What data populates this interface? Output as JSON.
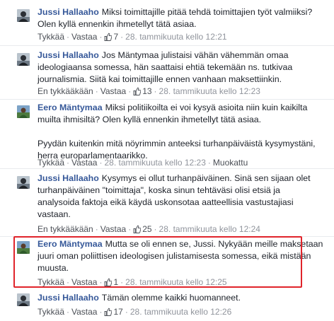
{
  "comments": [
    {
      "author": "Jussi Hallaaho",
      "text": "Miksi toimittajille pitää tehdä toimittajien työt valmiiksi? Olen kyllä ennenkin ihmetellyt tätä asiaa.",
      "like_label": "Tykkää",
      "reply_label": "Vastaa",
      "likes": "7",
      "timestamp": "28. tammikuuta kello 12:21",
      "avatar_icon": "profile-photo-icon"
    },
    {
      "author": "Jussi Hallaaho",
      "text": "Jos Mäntymaa julistaisi vähän vähemmän omaa ideologiaansa somessa, hän saattaisi ehtiä tekemään ns. tutkivaa journalismia. Siitä kai toimittajille ennen vanhaan maksettiinkin.",
      "like_label": "En tykkääkään",
      "reply_label": "Vastaa",
      "likes": "13",
      "timestamp": "28. tammikuuta kello 12:23",
      "avatar_icon": "profile-photo-icon"
    },
    {
      "author": "Eero Mäntymaa",
      "text": "Miksi politiikoilta ei voi kysyä asioita niin kuin kaikilta muilta ihmisiltä? Olen kyllä ennenkin ihmetellyt tätä asiaa.",
      "text2": "Pyydän kuitenkin mitä nöyrimmin anteeksi turhanpäiväistä kysymystäni, herra europarlamentaarikko.",
      "like_label": "Tykkää",
      "reply_label": "Vastaa",
      "timestamp": "28. tammikuuta kello 12:23",
      "edited_label": "Muokattu",
      "avatar_icon": "profile-photo-icon"
    },
    {
      "author": "Jussi Hallaaho",
      "text": "Kysymys ei ollut turhanpäiväinen. Sinä sen sijaan olet turhanpäiväinen \"toimittaja\", koska sinun tehtäväsi olisi etsiä ja analysoida faktoja eikä käydä uskonsotaa aatteellisia vastustajiasi vastaan.",
      "like_label": "En tykkääkään",
      "reply_label": "Vastaa",
      "likes": "25",
      "timestamp": "28. tammikuuta kello 12:24",
      "avatar_icon": "profile-photo-icon"
    },
    {
      "author": "Eero Mäntymaa",
      "text": "Mutta se oli ennen se, Jussi. Nykyään meille maksetaan juuri oman poliittisen ideologisen julistamisesta somessa, eikä mistään muusta.",
      "like_label": "Tykkää",
      "reply_label": "Vastaa",
      "likes": "1",
      "timestamp": "28. tammikuuta kello 12:25",
      "avatar_icon": "profile-photo-icon"
    },
    {
      "author": "Jussi Hallaaho",
      "text": "Tämän olemme kaikki huomanneet.",
      "like_label": "Tykkää",
      "reply_label": "Vastaa",
      "likes": "17",
      "timestamp": "28. tammikuuta kello 12:26",
      "avatar_icon": "profile-photo-icon"
    }
  ],
  "colors": {
    "author_link": "#365899",
    "meta_text": "#90949c",
    "highlight_border": "#e0242b",
    "separator": "#e9ebee"
  }
}
